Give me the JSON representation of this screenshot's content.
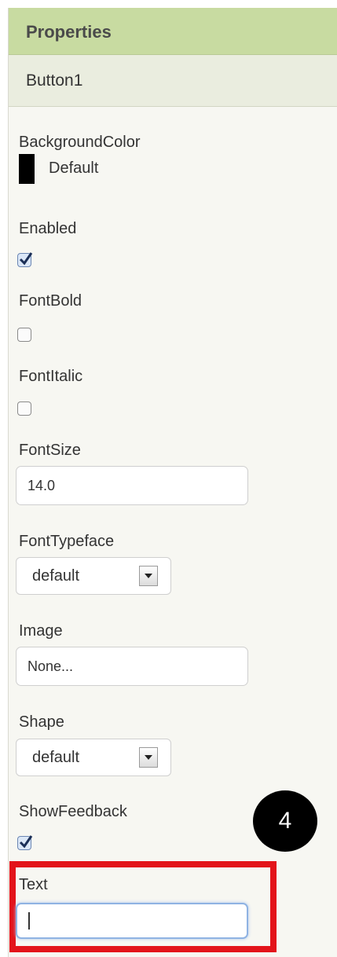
{
  "header": {
    "title": "Properties"
  },
  "component": {
    "name": "Button1"
  },
  "properties": {
    "background_color": {
      "label": "BackgroundColor",
      "value": "Default",
      "swatch_color": "#000000"
    },
    "enabled": {
      "label": "Enabled",
      "checked": true
    },
    "font_bold": {
      "label": "FontBold",
      "checked": false
    },
    "font_italic": {
      "label": "FontItalic",
      "checked": false
    },
    "font_size": {
      "label": "FontSize",
      "value": "14.0"
    },
    "font_typeface": {
      "label": "FontTypeface",
      "value": "default"
    },
    "image": {
      "label": "Image",
      "value": "None..."
    },
    "shape": {
      "label": "Shape",
      "value": "default"
    },
    "show_feedback": {
      "label": "ShowFeedback",
      "checked": true
    },
    "text": {
      "label": "Text",
      "value": ""
    }
  },
  "annotation": {
    "step_number": "4",
    "highlight_color": "#e3141b"
  },
  "colors": {
    "header_bg": "#c8dba1",
    "panel_bg": "#f7f7f2"
  }
}
